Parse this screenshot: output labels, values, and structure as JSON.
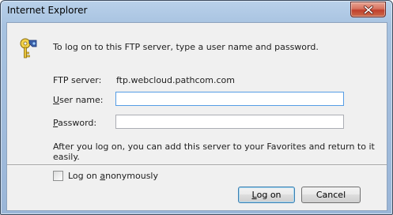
{
  "window": {
    "title": "Internet Explorer"
  },
  "dialog": {
    "intro": "To log on to this FTP server, type a user name and password.",
    "ftp_server_label": "FTP server:",
    "ftp_server_value": "ftp.webcloud.pathcom.com",
    "username_label_ul": "U",
    "username_label_rest": "ser name:",
    "username_value": "",
    "password_label_ul": "P",
    "password_label_rest": "assword:",
    "password_value": "",
    "note": "After you log on, you can add this server to your Favorites and return to it easily.",
    "anonymous_label_pre": "Log on ",
    "anonymous_label_ul": "a",
    "anonymous_label_rest": "nonymously",
    "anonymous_checked": false,
    "logon_button_ul": "L",
    "logon_button_rest": "og on",
    "cancel_button": "Cancel"
  },
  "icons": {
    "close": "close-icon",
    "key": "key-icon"
  }
}
